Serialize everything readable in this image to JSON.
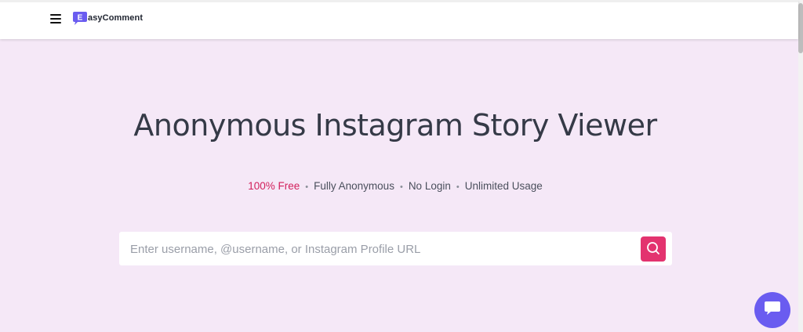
{
  "brand": {
    "logo_letter": "E",
    "name": "asyComment",
    "logo_color": "#6a5cf0"
  },
  "header": {
    "menu_icon": "hamburger-menu-icon"
  },
  "hero": {
    "title": "Anonymous Instagram Story Viewer",
    "features": [
      {
        "label": "100% Free",
        "color": "#d21f5b"
      },
      {
        "label": "Fully Anonymous"
      },
      {
        "label": "No Login"
      },
      {
        "label": "Unlimited Usage"
      }
    ],
    "separator": "•"
  },
  "search": {
    "placeholder": "Enter username, @username, or Instagram Profile URL",
    "value": "",
    "button_icon": "search-icon",
    "button_color": "#e3336f"
  },
  "chat": {
    "icon": "chat-bubble-icon",
    "color": "#6a5cf0"
  },
  "colors": {
    "page_background": "#f5e8f7",
    "title_text": "#353a47"
  }
}
